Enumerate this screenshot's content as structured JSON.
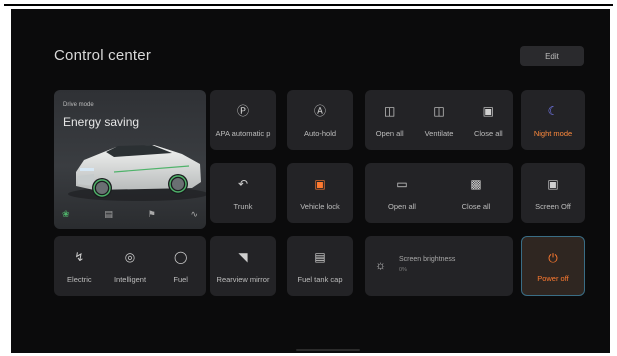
{
  "app": {
    "title": "Control center",
    "edit_label": "Edit"
  },
  "drive_mode": {
    "caption": "Drive mode",
    "value": "Energy saving",
    "icons": [
      "leaf-icon",
      "car-icon",
      "sport-icon",
      "route-icon"
    ]
  },
  "tiles": {
    "apa": "APA automatic p",
    "auto_hold": "Auto-hold",
    "window_open_all": "Open all",
    "window_ventilate": "Ventilate",
    "window_close_all": "Close all",
    "night_mode": "Night mode",
    "trunk": "Trunk",
    "vehicle_lock": "Vehicle lock",
    "sunshade_open_all": "Open all",
    "sunshade_close_all": "Close all",
    "screen_off": "Screen Off",
    "electric": "Electric",
    "intelligent": "Intelligent",
    "fuel": "Fuel",
    "rearview_mirror": "Rearview mirror",
    "fuel_tank_cap": "Fuel tank cap",
    "screen_brightness": "Screen brightness",
    "brightness_value": "0%",
    "power_off": "Power off"
  },
  "colors": {
    "background": "#0b0b0c",
    "tile": "#232326",
    "accent_orange": "#ff7a30",
    "accent_blue": "#7b80ff",
    "leaf_green": "#4fb36a"
  }
}
